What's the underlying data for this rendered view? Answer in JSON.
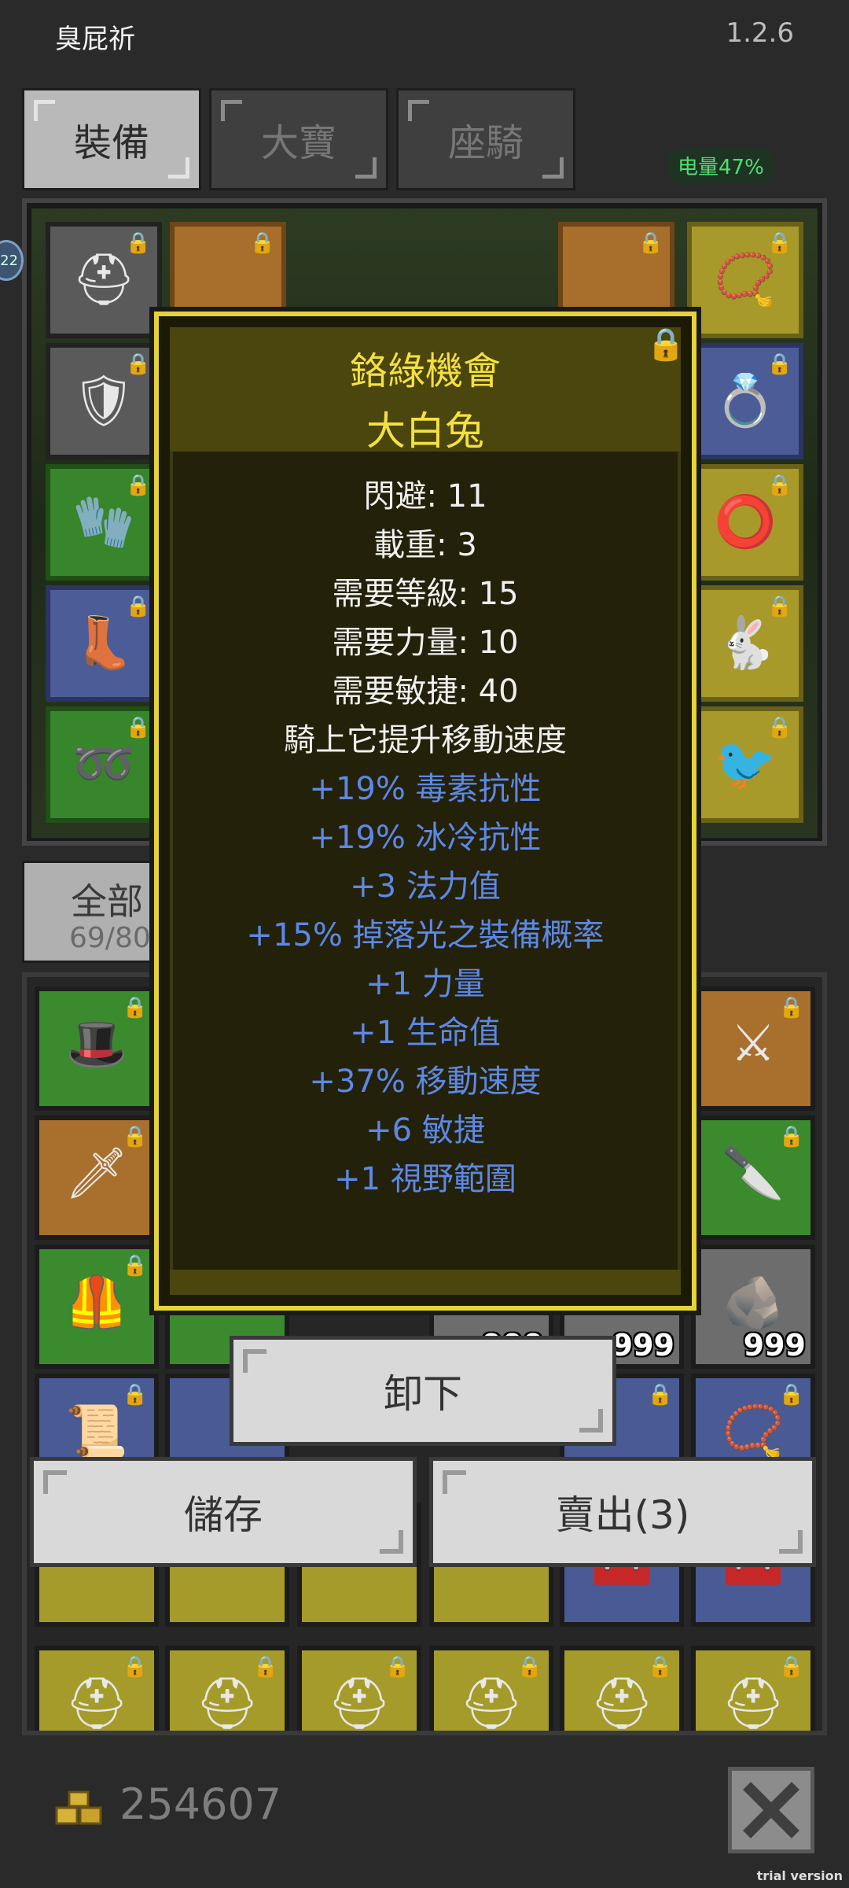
{
  "header": {
    "user_name": "臭屁祈",
    "version": "1.2.6",
    "battery": "电量47%"
  },
  "tabs": [
    {
      "label": "裝備",
      "active": true
    },
    {
      "label": "大寶",
      "active": false
    },
    {
      "label": "座騎",
      "active": false
    }
  ],
  "side_badge": "22",
  "category": {
    "label": "全部",
    "count": "69/80"
  },
  "tooltip": {
    "title": "鉻綠機會",
    "name": "大白兔",
    "stats": [
      "閃避: 11",
      "載重: 3",
      "需要等級: 15",
      "需要力量: 10",
      "需要敏捷: 40",
      "騎上它提升移動速度"
    ],
    "bonuses": [
      "+19% 毒素抗性",
      "+19% 冰冷抗性",
      "+3 法力值",
      "+15% 掉落光之裝備概率",
      "+1 力量",
      "+1 生命值",
      "+37% 移動速度",
      "+6 敏捷",
      "+1 視野範圍"
    ]
  },
  "actions": {
    "unequip": "卸下",
    "store": "儲存",
    "sell": "賣出(3)"
  },
  "inventory": {
    "qty_1": "999",
    "qty_2": "999",
    "qty_3": "999"
  },
  "footer": {
    "gold": "254607",
    "trial": "trial version"
  },
  "colors": {
    "tooltip_border": "#e6d33a",
    "title": "#f5e043",
    "bonus": "#5d88e6",
    "battery": "#4ee06e"
  }
}
